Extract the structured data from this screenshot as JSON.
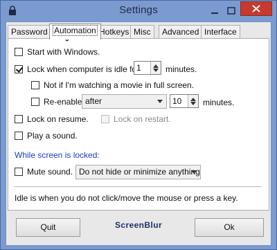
{
  "window": {
    "title": "Settings",
    "controls": {
      "minimize": "minimize-icon",
      "maximize": "maximize-icon",
      "close": "close-icon"
    }
  },
  "tabs": [
    "Password",
    "Automation",
    "Hotkeys",
    "Misc",
    "Advanced",
    "Interface"
  ],
  "active_tab": "Automation",
  "options": {
    "start_with_windows": {
      "label": "Start with Windows.",
      "checked": false
    },
    "lock_when_idle": {
      "label": "Lock when computer is idle for",
      "checked": true,
      "value": "1",
      "unit": "minutes."
    },
    "not_if_movie": {
      "label": "Not if I'm watching a movie in full screen.",
      "checked": false
    },
    "reenable": {
      "label": "Re-enable",
      "checked": false,
      "mode": "after",
      "value": "10",
      "unit": "minutes."
    },
    "lock_on_resume": {
      "label": "Lock on resume.",
      "checked": false
    },
    "lock_on_restart": {
      "label": "Lock on restart.",
      "checked": false,
      "enabled": false
    },
    "play_sound": {
      "label": "Play a sound.",
      "checked": false
    }
  },
  "while_locked": {
    "heading": "While screen is locked:",
    "mute_sound": {
      "label": "Mute sound.",
      "checked": false
    },
    "hide_option": "Do not hide or minimize anything"
  },
  "hint": "Idle is when you do not click/move the mouse or press a key.",
  "footer": {
    "quit_label": "Quit",
    "ok_label": "Ok",
    "brand": "ScreenBlur"
  },
  "colors": {
    "frame": "#7b9ad0",
    "close": "#c63a2f",
    "section_label": "#1a3fc1",
    "brand": "#1c2f6b"
  }
}
